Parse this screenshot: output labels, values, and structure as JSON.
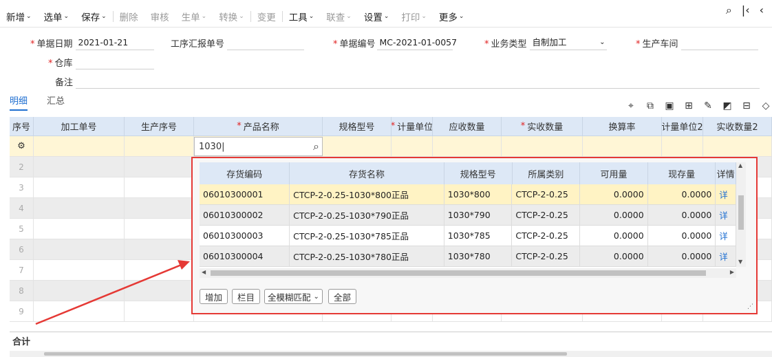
{
  "toolbar": {
    "items": [
      {
        "label": "新增",
        "dropdown": true,
        "disabled": false
      },
      {
        "label": "选单",
        "dropdown": true,
        "disabled": false
      },
      {
        "label": "保存",
        "dropdown": true,
        "disabled": false
      },
      {
        "label": "删除",
        "dropdown": false,
        "disabled": true
      },
      {
        "label": "审核",
        "dropdown": false,
        "disabled": true
      },
      {
        "label": "生单",
        "dropdown": true,
        "disabled": true
      },
      {
        "label": "转换",
        "dropdown": true,
        "disabled": true
      },
      {
        "label": "变更",
        "dropdown": false,
        "disabled": true
      },
      {
        "label": "工具",
        "dropdown": true,
        "disabled": false
      },
      {
        "label": "联查",
        "dropdown": true,
        "disabled": true
      },
      {
        "label": "设置",
        "dropdown": true,
        "disabled": false
      },
      {
        "label": "打印",
        "dropdown": true,
        "disabled": true
      },
      {
        "label": "更多",
        "dropdown": true,
        "disabled": false
      }
    ],
    "caret": "⌄",
    "right_icons": [
      "search-doc-icon",
      "first-page-icon",
      "back-icon"
    ]
  },
  "form": {
    "date_label": "单据日期",
    "date_value": "2021-01-21",
    "report_label": "工序汇报单号",
    "report_value": "",
    "code_label": "单据编号",
    "code_value": "MC-2021-01-0057",
    "type_label": "业务类型",
    "type_value": "自制加工",
    "workshop_label": "生产车间",
    "workshop_value": "",
    "warehouse_label": "仓库",
    "warehouse_value": "",
    "note_label": "备注",
    "note_value": ""
  },
  "tabs": [
    {
      "label": "明细",
      "active": true
    },
    {
      "label": "汇总",
      "active": false
    }
  ],
  "grid": {
    "columns": [
      {
        "label": "序号",
        "required": false
      },
      {
        "label": "加工单号",
        "required": false
      },
      {
        "label": "生产序号",
        "required": false
      },
      {
        "label": "产品名称",
        "required": true
      },
      {
        "label": "规格型号",
        "required": false
      },
      {
        "label": "计量单位",
        "required": true
      },
      {
        "label": "应收数量",
        "required": false
      },
      {
        "label": "实收数量",
        "required": true
      },
      {
        "label": "换算率",
        "required": false
      },
      {
        "label": "计量单位2",
        "required": false
      },
      {
        "label": "实收数量2",
        "required": false
      }
    ],
    "row_numbers": [
      "2",
      "3",
      "4",
      "5",
      "6",
      "7",
      "8",
      "9"
    ],
    "editing_value": "1030",
    "total_label": "合计"
  },
  "popup": {
    "columns": [
      "存货编码",
      "存货名称",
      "规格型号",
      "所属类别",
      "可用量",
      "现存量",
      "详情"
    ],
    "rows": [
      {
        "code": "06010300001",
        "name": "CTCP-2-0.25-1030*800正品",
        "spec": "1030*800",
        "category": "CTCP-2-0.25",
        "available": "0.0000",
        "stock": "0.0000",
        "detail": "详"
      },
      {
        "code": "06010300002",
        "name": "CTCP-2-0.25-1030*790正品",
        "spec": "1030*790",
        "category": "CTCP-2-0.25",
        "available": "0.0000",
        "stock": "0.0000",
        "detail": "详"
      },
      {
        "code": "06010300003",
        "name": "CTCP-2-0.25-1030*785正品",
        "spec": "1030*785",
        "category": "CTCP-2-0.25",
        "available": "0.0000",
        "stock": "0.0000",
        "detail": "详"
      },
      {
        "code": "06010300004",
        "name": "CTCP-2-0.25-1030*780正品",
        "spec": "1030*780",
        "category": "CTCP-2-0.25",
        "available": "0.0000",
        "stock": "0.0000",
        "detail": "详"
      }
    ],
    "add_label": "增加",
    "columns_label": "栏目",
    "match_value": "全模糊匹配",
    "all_label": "全部"
  },
  "colors": {
    "accent": "#1f6fd1",
    "highlight_border": "#e53935",
    "header_bg": "#dde8f6",
    "selected_row": "#fff3c4"
  }
}
